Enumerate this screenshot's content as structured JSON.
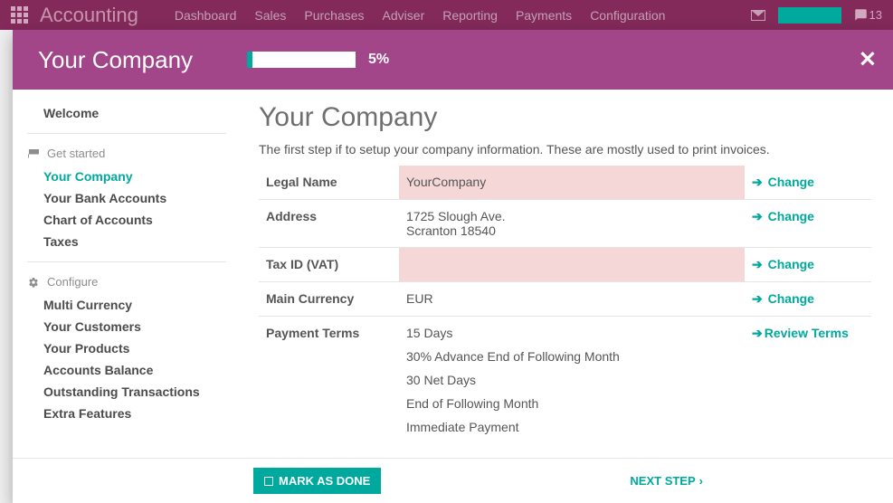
{
  "app": {
    "name": "Accounting",
    "nav": [
      "Dashboard",
      "Sales",
      "Purchases",
      "Adviser",
      "Reporting",
      "Payments",
      "Configuration"
    ],
    "chat_count": "13"
  },
  "modal": {
    "title": "Your Company",
    "progress_percent": 5,
    "progress_label": "5%"
  },
  "sidebar": {
    "welcome": "Welcome",
    "section_started": "Get started",
    "started_items": [
      "Your Company",
      "Your Bank Accounts",
      "Chart of Accounts",
      "Taxes"
    ],
    "section_configure": "Configure",
    "configure_items": [
      "Multi Currency",
      "Your Customers",
      "Your Products",
      "Accounts Balance",
      "Outstanding Transactions",
      "Extra Features"
    ]
  },
  "main": {
    "heading": "Your Company",
    "subtitle": "The first step if to setup your company information. These are mostly used to print invoices.",
    "rows": {
      "legal_name": {
        "label": "Legal Name",
        "value": "YourCompany",
        "action": "Change"
      },
      "address": {
        "label": "Address",
        "line1": "1725 Slough Ave.",
        "line2": "Scranton 18540",
        "action": "Change"
      },
      "tax_id": {
        "label": "Tax ID (VAT)",
        "value": "",
        "action": "Change"
      },
      "currency": {
        "label": "Main Currency",
        "value": "EUR",
        "action": "Change"
      },
      "payment_terms": {
        "label": "Payment Terms",
        "values": [
          "15 Days",
          "30% Advance End of Following Month",
          "30 Net Days",
          "End of Following Month",
          "Immediate Payment"
        ],
        "action": "Review Terms"
      }
    }
  },
  "footer": {
    "mark_done": "MARK AS DONE",
    "next_step": "NEXT STEP"
  }
}
